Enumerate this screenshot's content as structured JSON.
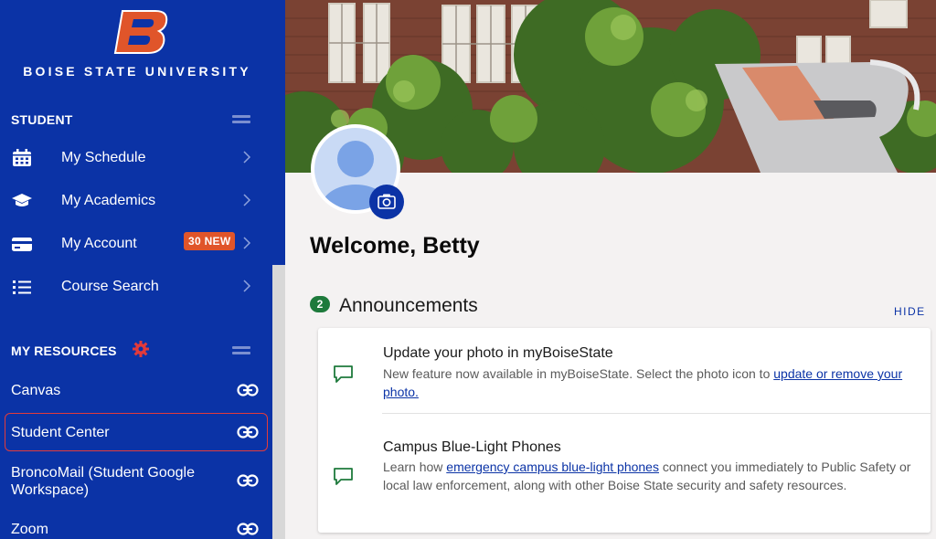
{
  "sidebar": {
    "university_name": "BOISE STATE UNIVERSITY",
    "student_section": {
      "heading": "STUDENT",
      "items": [
        {
          "label": "My Schedule",
          "icon": "calendar-icon"
        },
        {
          "label": "My Academics",
          "icon": "graduation-cap-icon"
        },
        {
          "label": "My Account",
          "icon": "credit-card-icon",
          "badge": "30 NEW"
        },
        {
          "label": "Course Search",
          "icon": "list-icon"
        }
      ]
    },
    "resources_section": {
      "heading": "MY RESOURCES",
      "items": [
        {
          "label": "Canvas"
        },
        {
          "label": "Student Center"
        },
        {
          "label": "BroncoMail (Student Google Workspace)"
        },
        {
          "label": "Zoom"
        }
      ]
    }
  },
  "main": {
    "welcome": "Welcome, Betty",
    "announcements": {
      "count": "2",
      "title": "Announcements",
      "hide_label": "HIDE",
      "items": [
        {
          "title": "Update your photo in myBoiseState",
          "body_prefix": "New feature now available in myBoiseState. Select the photo icon to ",
          "link_text": "update or remove your photo.",
          "body_suffix": ""
        },
        {
          "title": "Campus Blue-Light Phones",
          "body_prefix": "Learn how ",
          "link_text": "emergency campus blue-light phones",
          "body_suffix": " connect you immediately to Public Safety or local law enforcement, along with other Boise State security and safety resources."
        }
      ]
    }
  },
  "colors": {
    "sidebar_bg": "#0b33a6",
    "brand_orange": "#e0552a",
    "badge_green": "#1e7a3c",
    "highlight_red": "#e33b3b"
  }
}
